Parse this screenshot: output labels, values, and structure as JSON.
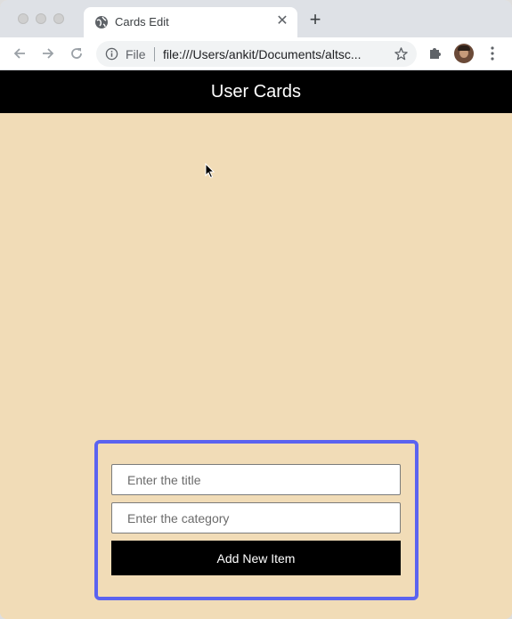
{
  "browser": {
    "tab": {
      "title": "Cards Edit",
      "close_glyph": "✕"
    },
    "new_tab_glyph": "+",
    "omnibox": {
      "scheme_label": "File",
      "url": "file:///Users/ankit/Documents/altsc..."
    },
    "icons": {
      "back": "arrow-left-icon",
      "forward": "arrow-right-icon",
      "reload": "reload-icon",
      "info": "info-icon",
      "star": "star-icon",
      "extensions": "puzzle-icon",
      "menu": "kebab-menu-icon"
    }
  },
  "app": {
    "header": {
      "title": "User Cards"
    },
    "form": {
      "title_field": {
        "value": "",
        "placeholder": "Enter the title"
      },
      "category_field": {
        "value": "",
        "placeholder": "Enter the category"
      },
      "submit_label": "Add New Item"
    }
  },
  "colors": {
    "page_background": "#f1dcb7",
    "header_background": "#000000",
    "form_border": "#5b63f0",
    "button_background": "#000000"
  }
}
